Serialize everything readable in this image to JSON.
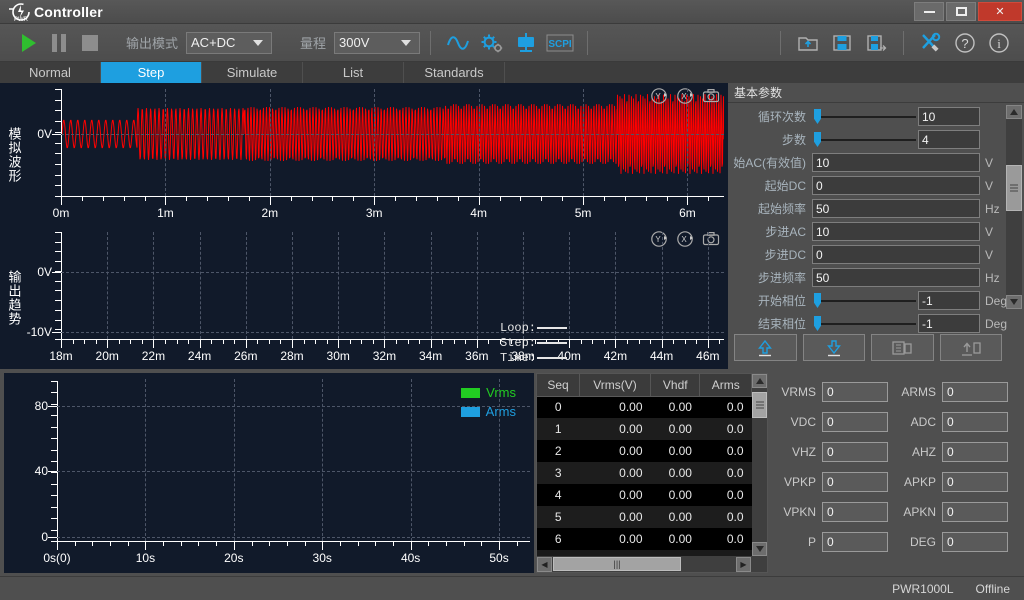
{
  "window": {
    "title": "Controller",
    "logo_icon": "pwr-logo-icon",
    "minimize_label": "minimize",
    "maximize_label": "maximize",
    "close_label": "✕"
  },
  "toolbar": {
    "play_label": "run",
    "pause_label": "pause",
    "stop_label": "stop",
    "output_mode_label": "输出模式",
    "output_mode_value": "AC+DC",
    "range_label": "量程",
    "range_value": "300V",
    "icons": [
      "waveform-icon",
      "settings-gear-icon",
      "monitor-icon",
      "scpi-icon"
    ],
    "scpi_text": "SCPI",
    "right_icons": [
      "open-file-icon",
      "save-icon",
      "save-as-icon",
      "tools-icon",
      "help-icon",
      "info-icon"
    ]
  },
  "tabs": [
    {
      "label": "Normal",
      "active": false
    },
    {
      "label": "Step",
      "active": true
    },
    {
      "label": "Simulate",
      "active": false
    },
    {
      "label": "List",
      "active": false
    },
    {
      "label": "Standards",
      "active": false
    }
  ],
  "charts": {
    "analog": {
      "axis_label": "模拟波形",
      "y_ticks": [
        "0V"
      ],
      "x_ticks": [
        "0m",
        "1m",
        "2m",
        "3m",
        "4m",
        "5m",
        "6m"
      ],
      "trace_color": "#ff0000",
      "icons": [
        "reset-y-icon",
        "reset-x-icon",
        "camera-icon"
      ]
    },
    "trend": {
      "axis_label": "输出趋势",
      "y_ticks": [
        "0V",
        "-10V"
      ],
      "x_ticks": [
        "18m",
        "20m",
        "22m",
        "24m",
        "26m",
        "28m",
        "30m",
        "32m",
        "34m",
        "36m",
        "38m",
        "40m",
        "42m",
        "44m",
        "46m"
      ],
      "overlay": [
        {
          "label": "Loop:",
          "value": ""
        },
        {
          "label": "Step:",
          "value": ""
        },
        {
          "label": "Time:",
          "value": ""
        }
      ],
      "icons": [
        "reset-y-icon",
        "reset-x-icon",
        "camera-icon"
      ]
    }
  },
  "params": {
    "title": "基本参数",
    "rows": [
      {
        "label": "循环次数",
        "type": "slider",
        "value": "10",
        "unit": ""
      },
      {
        "label": "步数",
        "type": "slider",
        "value": "4",
        "unit": ""
      },
      {
        "label": "始AC(有效值)",
        "type": "field",
        "value": "10",
        "unit": "V"
      },
      {
        "label": "起始DC",
        "type": "field",
        "value": "0",
        "unit": "V"
      },
      {
        "label": "起始频率",
        "type": "field",
        "value": "50",
        "unit": "Hz"
      },
      {
        "label": "步进AC",
        "type": "field",
        "value": "10",
        "unit": "V"
      },
      {
        "label": "步进DC",
        "type": "field",
        "value": "0",
        "unit": "V"
      },
      {
        "label": "步进频率",
        "type": "field",
        "value": "50",
        "unit": "Hz"
      },
      {
        "label": "开始相位",
        "type": "slider",
        "value": "-1",
        "unit": "Deg"
      },
      {
        "label": "结束相位",
        "type": "slider",
        "value": "-1",
        "unit": "Deg"
      }
    ],
    "buttons": [
      "upload-icon",
      "download-icon",
      "copy-file-icon",
      "export-file-icon"
    ]
  },
  "chart_data": {
    "type": "line",
    "title": "",
    "xlabel": "",
    "ylabel": "",
    "categories": [
      "0s(0)",
      "10s",
      "20s",
      "30s",
      "40s",
      "50s"
    ],
    "x_ticks": [
      "0s(0)",
      "10s",
      "20s",
      "30s",
      "40s",
      "50s"
    ],
    "y_ticks": [
      "0",
      "40",
      "80"
    ],
    "ylim": [
      0,
      90
    ],
    "grid": true,
    "legend_position": "top-right",
    "series": [
      {
        "name": "Vrms",
        "color": "#22cc22",
        "values": []
      },
      {
        "name": "Arms",
        "color": "#1e9fe0",
        "values": []
      }
    ]
  },
  "table": {
    "columns": [
      "Seq",
      "Vrms(V)",
      "Vhdf",
      "Arms"
    ],
    "rows": [
      {
        "seq": "0",
        "vrms": "0.00",
        "vhdf": "0.00",
        "arms": "0.0"
      },
      {
        "seq": "1",
        "vrms": "0.00",
        "vhdf": "0.00",
        "arms": "0.0"
      },
      {
        "seq": "2",
        "vrms": "0.00",
        "vhdf": "0.00",
        "arms": "0.0"
      },
      {
        "seq": "3",
        "vrms": "0.00",
        "vhdf": "0.00",
        "arms": "0.0"
      },
      {
        "seq": "4",
        "vrms": "0.00",
        "vhdf": "0.00",
        "arms": "0.0"
      },
      {
        "seq": "5",
        "vrms": "0.00",
        "vhdf": "0.00",
        "arms": "0.0"
      },
      {
        "seq": "6",
        "vrms": "0.00",
        "vhdf": "0.00",
        "arms": "0.0"
      }
    ]
  },
  "measurements": [
    [
      {
        "label": "VRMS",
        "value": "0"
      },
      {
        "label": "ARMS",
        "value": "0"
      }
    ],
    [
      {
        "label": "VDC",
        "value": "0"
      },
      {
        "label": "ADC",
        "value": "0"
      }
    ],
    [
      {
        "label": "VHZ",
        "value": "0"
      },
      {
        "label": "AHZ",
        "value": "0"
      }
    ],
    [
      {
        "label": "VPKP",
        "value": "0"
      },
      {
        "label": "APKP",
        "value": "0"
      }
    ],
    [
      {
        "label": "VPKN",
        "value": "0"
      },
      {
        "label": "APKN",
        "value": "0"
      }
    ],
    [
      {
        "label": "P",
        "value": "0"
      },
      {
        "label": "DEG",
        "value": "0"
      }
    ]
  ],
  "statusbar": {
    "model": "PWR1000L",
    "connection": "Offline"
  }
}
